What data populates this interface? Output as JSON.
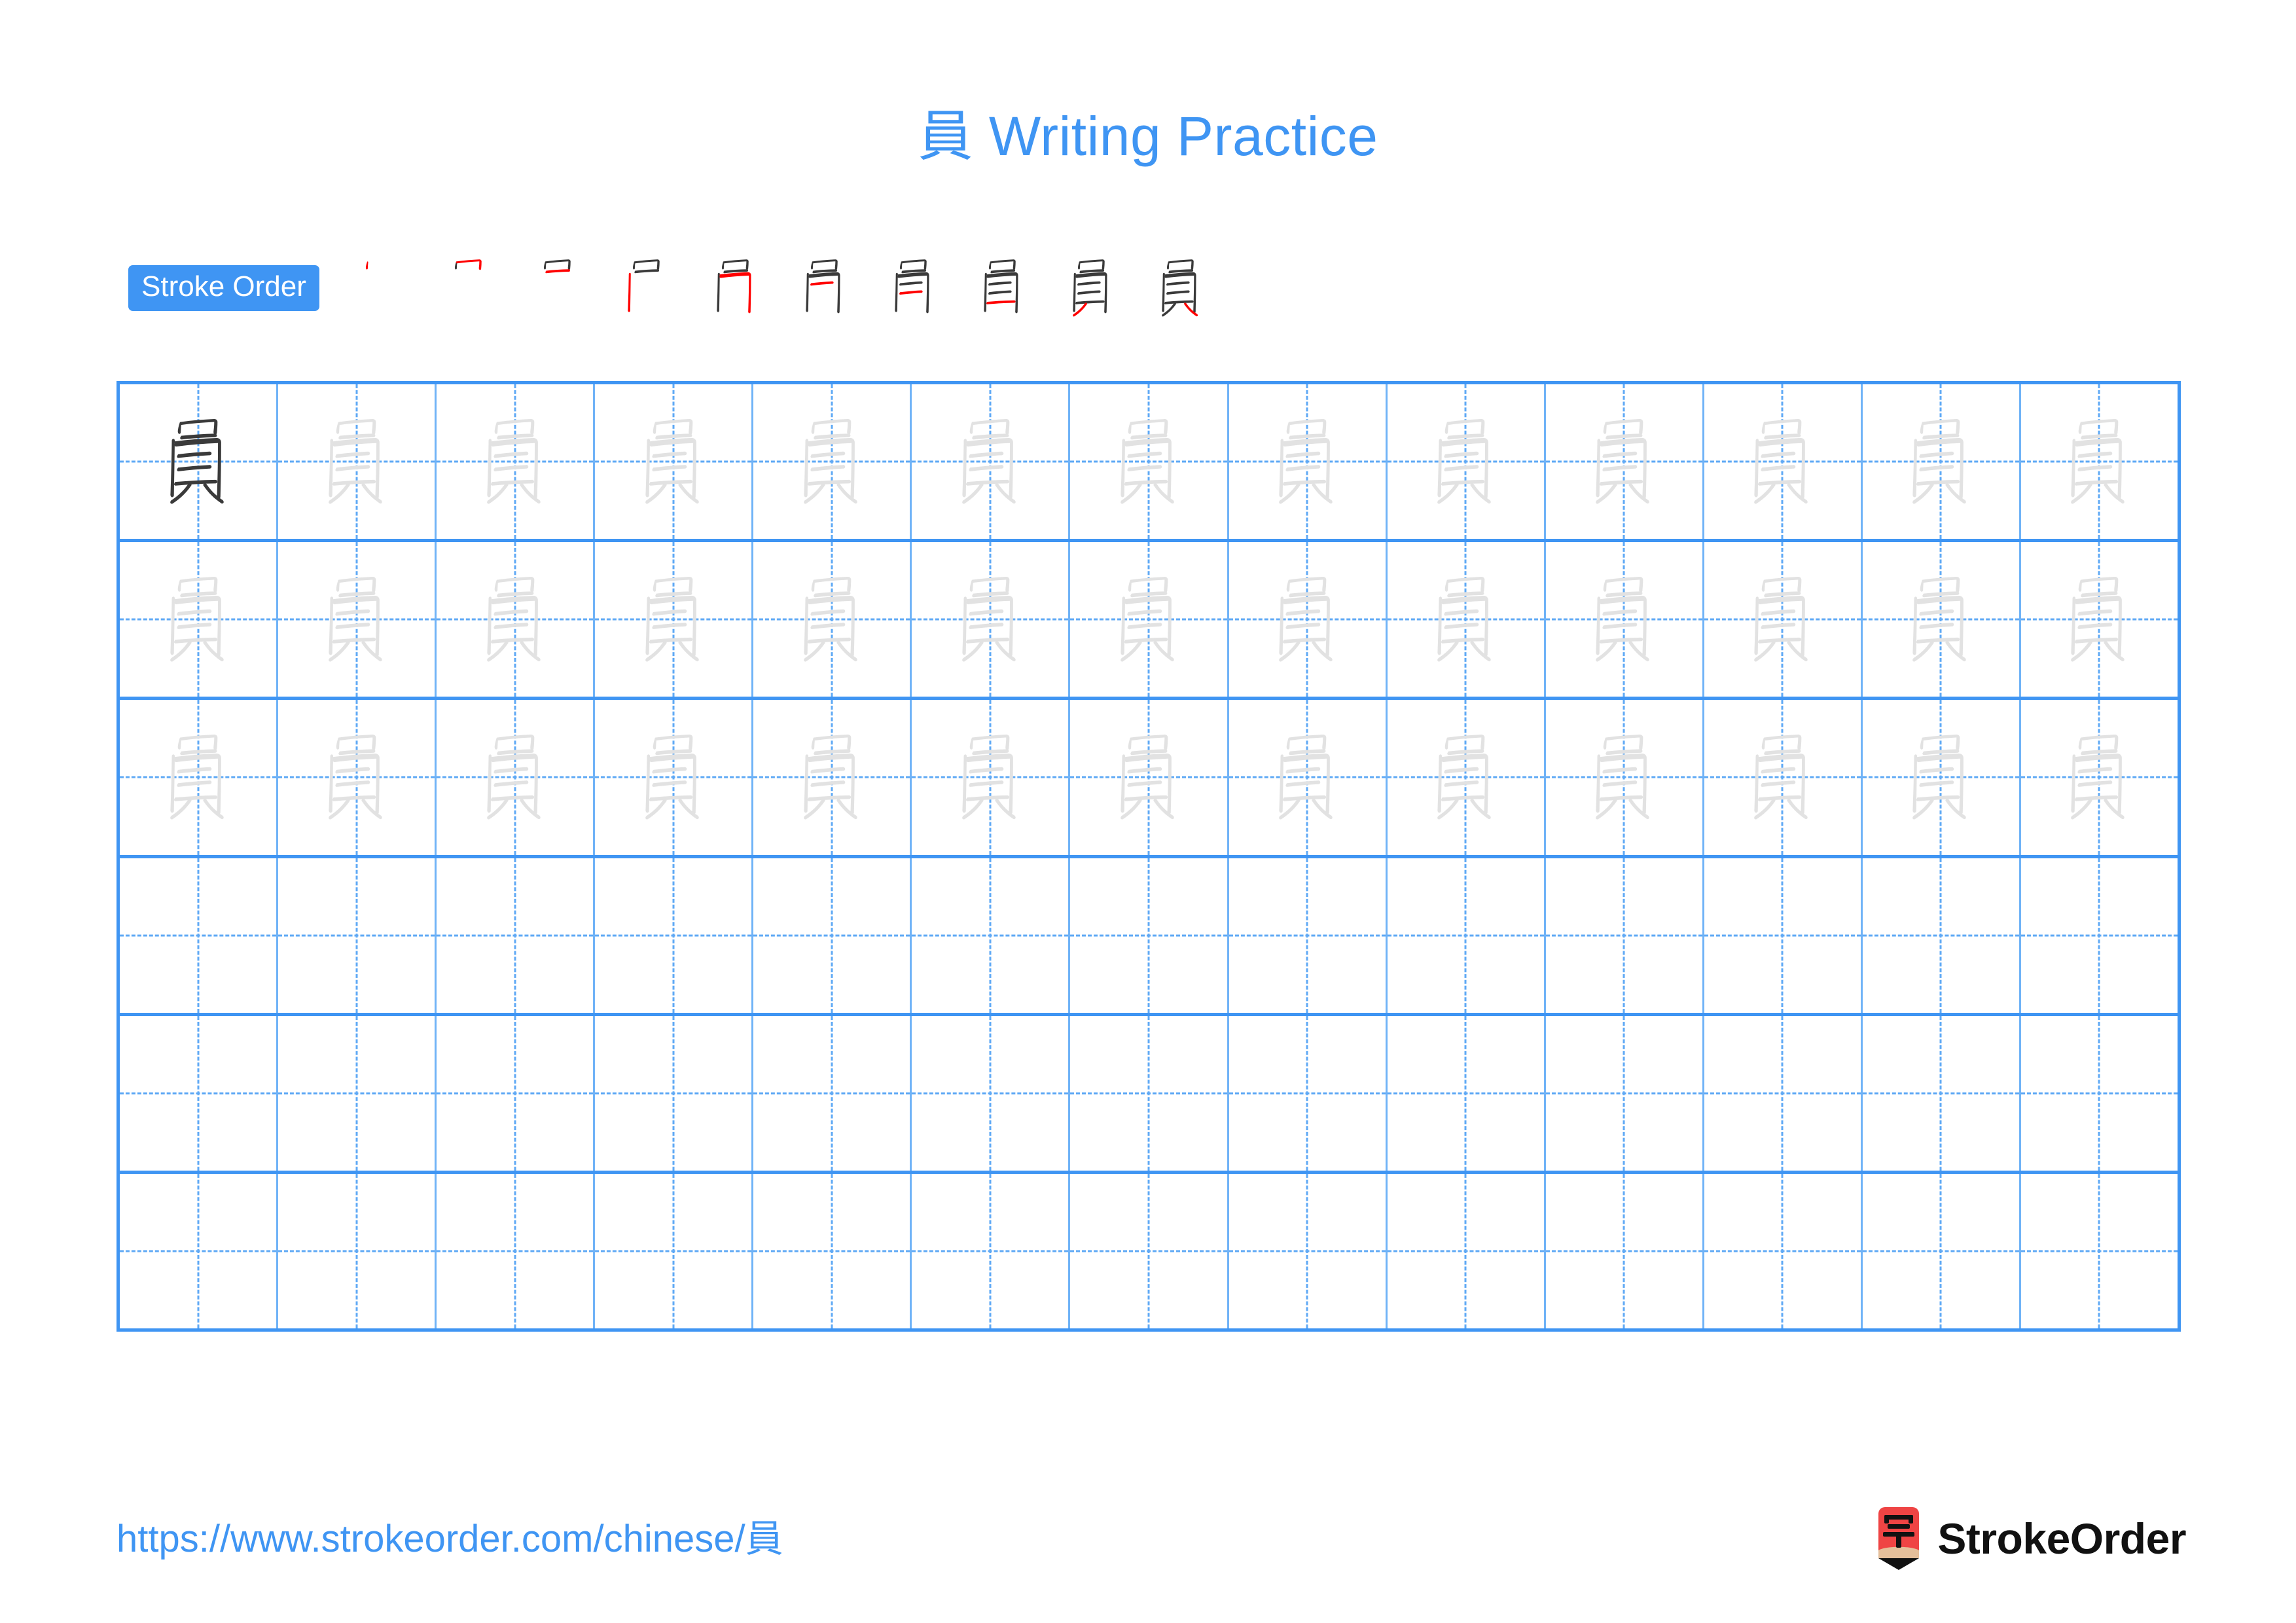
{
  "page": {
    "character": "員",
    "background_color": "#ffffff",
    "accent_color": "#3f95f3",
    "grid_line_color": "#3f95f3",
    "guide_line_color": "#5fa9f5",
    "trace_glyph_color": "#e2e2e2",
    "model_glyph_color": "#3a3a3a",
    "stroke_new_color": "#ff0000",
    "stroke_old_color": "#3a3a3a"
  },
  "header": {
    "title": "員 Writing Practice"
  },
  "stroke_order": {
    "badge_label": "Stroke Order",
    "total_strokes": 10,
    "steps": [
      {
        "index": 1,
        "strokes_shown": 1,
        "new_stroke": 1
      },
      {
        "index": 2,
        "strokes_shown": 2,
        "new_stroke": 2
      },
      {
        "index": 3,
        "strokes_shown": 3,
        "new_stroke": 3
      },
      {
        "index": 4,
        "strokes_shown": 4,
        "new_stroke": 4
      },
      {
        "index": 5,
        "strokes_shown": 5,
        "new_stroke": 5
      },
      {
        "index": 6,
        "strokes_shown": 6,
        "new_stroke": 6
      },
      {
        "index": 7,
        "strokes_shown": 7,
        "new_stroke": 7
      },
      {
        "index": 8,
        "strokes_shown": 8,
        "new_stroke": 8
      },
      {
        "index": 9,
        "strokes_shown": 9,
        "new_stroke": 9
      },
      {
        "index": 10,
        "strokes_shown": 10,
        "new_stroke": 10
      }
    ]
  },
  "practice_grid": {
    "columns": 13,
    "rows": 6,
    "rows_data": [
      {
        "row": 1,
        "cells": [
          "model",
          "trace",
          "trace",
          "trace",
          "trace",
          "trace",
          "trace",
          "trace",
          "trace",
          "trace",
          "trace",
          "trace",
          "trace"
        ]
      },
      {
        "row": 2,
        "cells": [
          "trace",
          "trace",
          "trace",
          "trace",
          "trace",
          "trace",
          "trace",
          "trace",
          "trace",
          "trace",
          "trace",
          "trace",
          "trace"
        ]
      },
      {
        "row": 3,
        "cells": [
          "trace",
          "trace",
          "trace",
          "trace",
          "trace",
          "trace",
          "trace",
          "trace",
          "trace",
          "trace",
          "trace",
          "trace",
          "trace"
        ]
      },
      {
        "row": 4,
        "cells": [
          "empty",
          "empty",
          "empty",
          "empty",
          "empty",
          "empty",
          "empty",
          "empty",
          "empty",
          "empty",
          "empty",
          "empty",
          "empty"
        ]
      },
      {
        "row": 5,
        "cells": [
          "empty",
          "empty",
          "empty",
          "empty",
          "empty",
          "empty",
          "empty",
          "empty",
          "empty",
          "empty",
          "empty",
          "empty",
          "empty"
        ]
      },
      {
        "row": 6,
        "cells": [
          "empty",
          "empty",
          "empty",
          "empty",
          "empty",
          "empty",
          "empty",
          "empty",
          "empty",
          "empty",
          "empty",
          "empty",
          "empty"
        ]
      }
    ]
  },
  "footer": {
    "url": "https://www.strokeorder.com/chinese/員",
    "brand_name": "StrokeOrder",
    "logo_character": "字",
    "logo_body_color": "#ef4444",
    "logo_tip_color": "#e5bf9a",
    "logo_point_color": "#111111"
  }
}
